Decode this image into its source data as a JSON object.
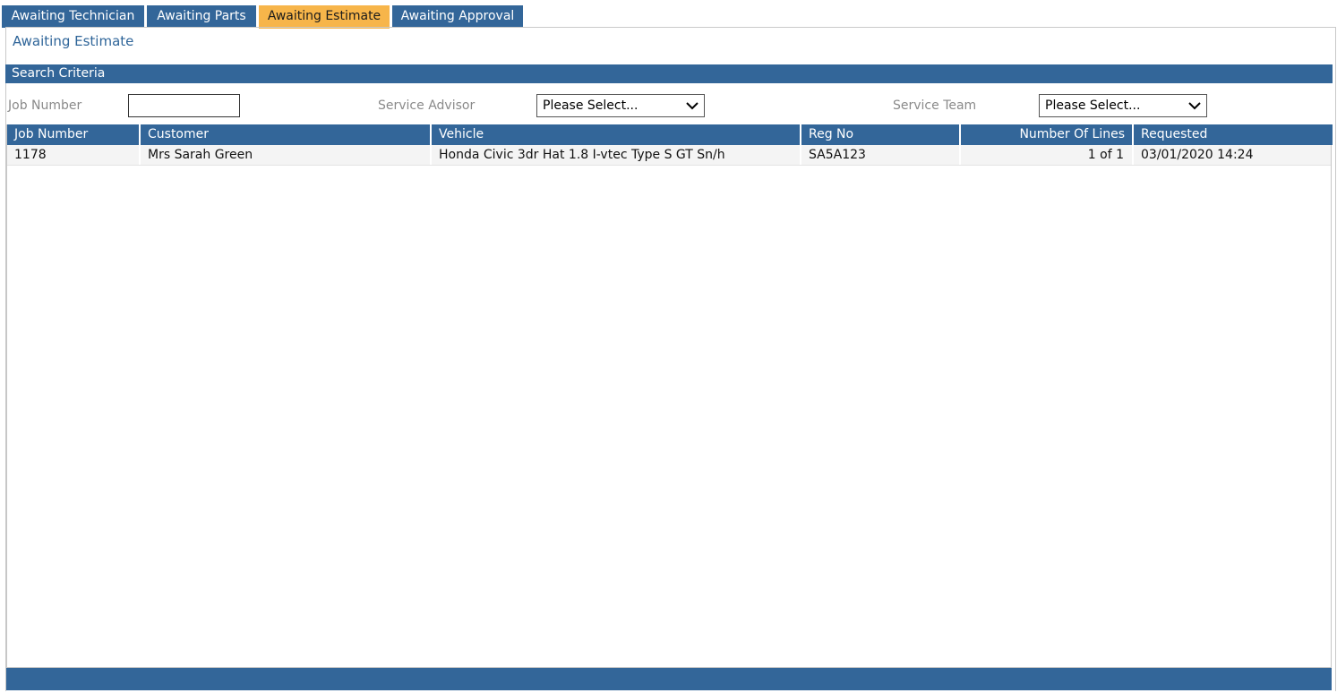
{
  "tabs": [
    {
      "label": "Awaiting Technician",
      "active": false
    },
    {
      "label": "Awaiting Parts",
      "active": false
    },
    {
      "label": "Awaiting Estimate",
      "active": true
    },
    {
      "label": "Awaiting Approval",
      "active": false
    }
  ],
  "page_title": "Awaiting Estimate",
  "search": {
    "header": "Search Criteria",
    "job_number_label": "Job Number",
    "job_number_value": "",
    "service_advisor_label": "Service Advisor",
    "service_advisor_value": "Please Select...",
    "service_team_label": "Service Team",
    "service_team_value": "Please Select..."
  },
  "grid": {
    "columns": [
      "Job Number",
      "Customer",
      "Vehicle",
      "Reg No",
      "Number Of Lines",
      "Requested"
    ],
    "rows": [
      [
        "1178",
        "Mrs Sarah Green",
        "Honda Civic 3dr Hat 1.8 I-vtec Type S GT Sn/h",
        "SA5A123",
        "1 of 1",
        "03/01/2020 14:24"
      ]
    ]
  },
  "colors": {
    "header_blue": "#336699",
    "active_tab": "#f7b54a",
    "title_blue": "#2f6599"
  }
}
